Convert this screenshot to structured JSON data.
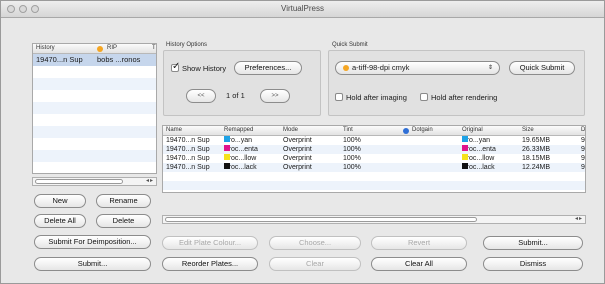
{
  "window": {
    "title": "VirtualPress"
  },
  "history": {
    "columns": [
      "History",
      "RIP",
      "T"
    ],
    "rip_dot_color": "#f5a623",
    "selected_row": {
      "history": "19470...n Sup",
      "rip": "bobs ...ronos"
    }
  },
  "left_buttons": {
    "new": "New",
    "rename": "Rename",
    "delete_all": "Delete All",
    "delete": "Delete",
    "submit_for_deimposition": "Submit For Deimposition...",
    "submit": "Submit..."
  },
  "history_options": {
    "label": "History Options",
    "show_history": "Show History",
    "show_history_checked": true,
    "preferences": "Preferences...",
    "prev": "<<",
    "page_indicator": "1 of 1",
    "next": ">>"
  },
  "quick_submit": {
    "label": "Quick Submit",
    "selected_option": "a-tiff-98-dpi cmyk",
    "option_dot_color": "#f5a623",
    "button": "Quick Submit",
    "hold_after_imaging": "Hold after imaging",
    "hold_after_rendering": "Hold after rendering"
  },
  "separations": {
    "columns": [
      "Name",
      "Remapped",
      "Mode",
      "Tint",
      "Dotgain",
      "Original",
      "Size",
      "D"
    ],
    "dotgain_dot_color": "#2f6fd6",
    "rows": [
      {
        "name": "19470...n Sup",
        "remapped": "Pro...yan",
        "remapped_color": "#1fa3e6",
        "mode": "Overprint",
        "tint": "100%",
        "original": "Pro...yan",
        "original_color": "#1fa3e6",
        "size": "19.65MB",
        "d": "9"
      },
      {
        "name": "19470...n Sup",
        "remapped": "Proc...enta",
        "remapped_color": "#e0148c",
        "mode": "Overprint",
        "tint": "100%",
        "original": "Proc...enta",
        "original_color": "#e0148c",
        "size": "26.33MB",
        "d": "9"
      },
      {
        "name": "19470...n Sup",
        "remapped": "Proc...llow",
        "remapped_color": "#f5e21c",
        "mode": "Overprint",
        "tint": "100%",
        "original": "Proc...llow",
        "original_color": "#f5e21c",
        "size": "18.15MB",
        "d": "9"
      },
      {
        "name": "19470...n Sup",
        "remapped": "Proc...lack",
        "remapped_color": "#111111",
        "mode": "Overprint",
        "tint": "100%",
        "original": "Proc...lack",
        "original_color": "#111111",
        "size": "12.24MB",
        "d": "9"
      }
    ]
  },
  "bottom_buttons": {
    "edit_plate_colour": "Edit Plate Colour...",
    "choose": "Choose...",
    "revert": "Revert",
    "submit": "Submit...",
    "reorder_plates": "Reorder Plates...",
    "clear": "Clear",
    "clear_all": "Clear All",
    "dismiss": "Dismiss"
  }
}
